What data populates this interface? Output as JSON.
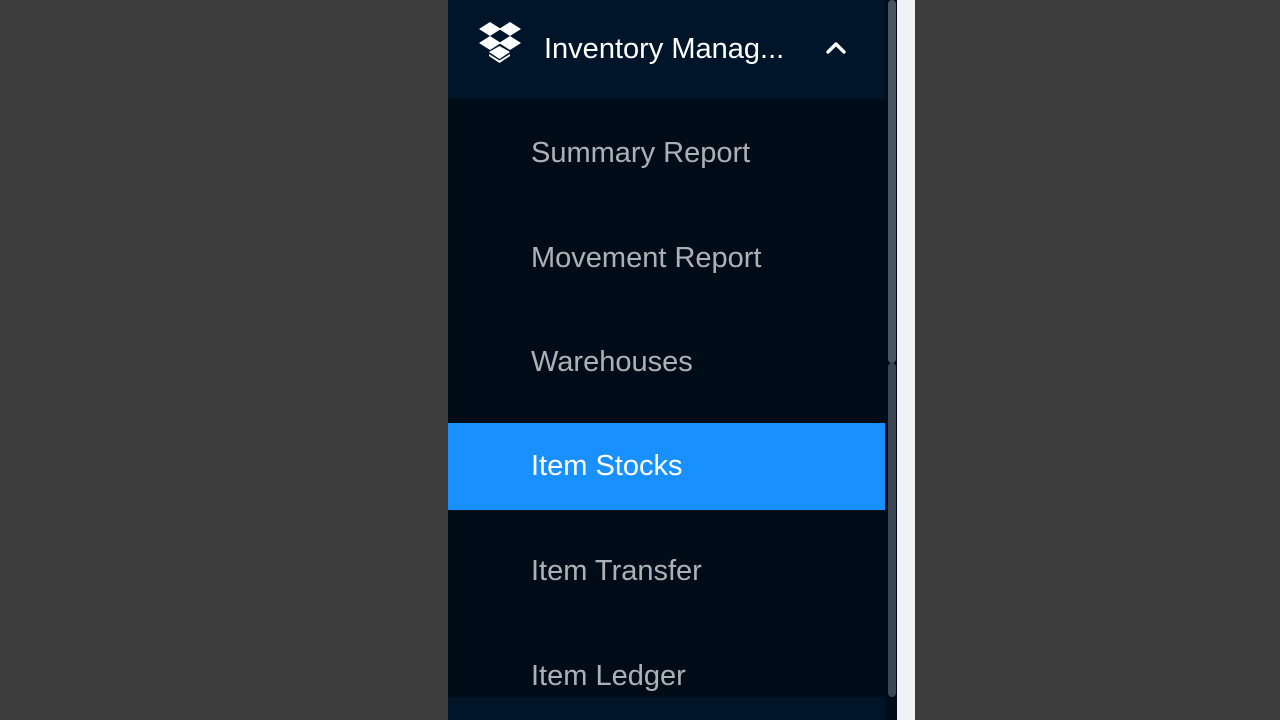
{
  "sidebar": {
    "submenu": {
      "icon": "dropbox-icon",
      "label": "Inventory Manag...",
      "chevron": "chevron-up-icon",
      "expanded": true
    },
    "items": [
      {
        "label": "Summary Report",
        "selected": false
      },
      {
        "label": "Movement Report",
        "selected": false
      },
      {
        "label": "Warehouses",
        "selected": false
      },
      {
        "label": "Item Stocks",
        "selected": true
      },
      {
        "label": "Item Transfer",
        "selected": false
      },
      {
        "label": "Item Ledger",
        "selected": false
      }
    ]
  },
  "colors": {
    "background": "#3d3d3d",
    "sidebar_header": "#001529",
    "sidebar_menu": "#000c17",
    "selected": "#1890ff",
    "text_inactive": "#a6adb4",
    "text_active": "#ffffff"
  }
}
